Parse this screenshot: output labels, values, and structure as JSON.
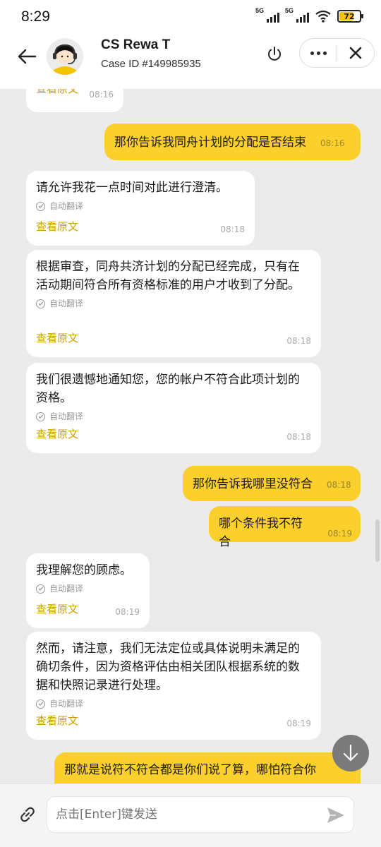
{
  "status": {
    "time": "8:29",
    "signal1_label": "5G",
    "signal2_label": "5G",
    "battery": "72",
    "battery_level": 0.72
  },
  "header": {
    "name": "CS Rewa T",
    "case_id": "Case ID #149985935"
  },
  "messages": [
    {
      "side": "in",
      "text": "",
      "translate_label": "",
      "original_label": "查看原文",
      "time": "08:16"
    },
    {
      "side": "out",
      "text": "那你告诉我同舟计划的分配是否结束",
      "time": "08:16"
    },
    {
      "side": "in",
      "text": "请允许我花一点时间对此进行澄清。",
      "translate_label": "自动翻译",
      "original_label": "查看原文",
      "time": "08:18"
    },
    {
      "side": "in",
      "text": "根据审查，同舟共济计划的分配已经完成，只有在活动期间符合所有资格标准的用户才收到了分配。",
      "translate_label": "自动翻译",
      "original_label": "查看原文",
      "time": "08:18"
    },
    {
      "side": "in",
      "text": "我们很遗憾地通知您，您的帐户不符合此项计划的资格。",
      "translate_label": "自动翻译",
      "original_label": "查看原文",
      "time": "08:18"
    },
    {
      "side": "out",
      "text": "那你告诉我哪里没符合",
      "time": "08:18"
    },
    {
      "side": "out",
      "text": "哪个条件我不符合",
      "time": "08:19"
    },
    {
      "side": "in",
      "text": "我理解您的顾虑。",
      "translate_label": "自动翻译",
      "original_label": "查看原文",
      "time": "08:19"
    },
    {
      "side": "in",
      "text": "然而，请注意，我们无法定位或具体说明未满足的确切条件，因为资格评估由相关团队根据系统的数据和快照记录进行处理。",
      "translate_label": "自动翻译",
      "original_label": "查看原文",
      "time": "08:19"
    },
    {
      "side": "out",
      "text": "那就是说符不符合都是你们说了算，哪怕符合你",
      "time": ""
    }
  ],
  "input": {
    "placeholder": "点击[Enter]键发送"
  },
  "colors": {
    "accent": "#fcd02c",
    "link": "#c9a100",
    "background": "#ebebeb"
  },
  "icons": {
    "back": "arrow-left-icon",
    "power": "power-icon",
    "more": "more-dots-icon",
    "close": "close-icon",
    "attach": "link-icon",
    "send": "send-icon",
    "scroll_down": "arrow-down-icon"
  }
}
